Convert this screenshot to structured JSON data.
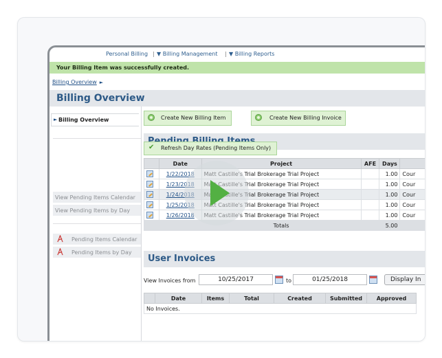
{
  "nav": {
    "personal": "Personal Billing",
    "sep": "|",
    "management": "▼ Billing Management",
    "reports": "▼ Billing Reports"
  },
  "alert": {
    "message": "Your Billing Item was successfully created."
  },
  "breadcrumb": {
    "item": "Billing Overview",
    "arrow": "►"
  },
  "page": {
    "title": "Billing Overview"
  },
  "sidebar": {
    "active": "Billing Overview",
    "active_marker": "►",
    "links": [
      "View Pending Items Calendar",
      "View Pending Items by Day"
    ],
    "pdf_links": [
      "Pending Items Calendar",
      "Pending Items by Day"
    ]
  },
  "actions": {
    "create_item": "Create New Billing Item",
    "create_invoice": "Create New Billing Invoice"
  },
  "pending": {
    "title": "Pending Billing Items",
    "refresh": "Refresh Day Rates (Pending Items Only)",
    "columns": [
      "Date",
      "Project",
      "AFE",
      "Days"
    ],
    "rows": [
      {
        "date": "1/22/2018",
        "project": "Matt Castille's Trial Brokerage Trial Project",
        "afe": "",
        "days": "1.00",
        "extra": "Cour"
      },
      {
        "date": "1/23/2018",
        "project": "Matt Castille's Trial Brokerage Trial Project",
        "afe": "",
        "days": "1.00",
        "extra": "Cour"
      },
      {
        "date": "1/24/2018",
        "project": "Matt Castille's Trial Brokerage Trial Project",
        "afe": "",
        "days": "1.00",
        "extra": "Cour"
      },
      {
        "date": "1/25/2018",
        "project": "Matt Castille's Trial Brokerage Trial Project",
        "afe": "",
        "days": "1.00",
        "extra": "Cour"
      },
      {
        "date": "1/26/2018",
        "project": "Matt Castille's Trial Brokerage Trial Project",
        "afe": "",
        "days": "1.00",
        "extra": "Cour"
      }
    ],
    "totals_label": "Totals",
    "totals_days": "5.00"
  },
  "invoices": {
    "title": "User Invoices",
    "from_label": "View Invoices from",
    "from_date": "10/25/2017",
    "to_label": "to",
    "to_date": "01/25/2018",
    "display_button": "Display In",
    "columns": [
      "Date",
      "Items",
      "Total",
      "Created",
      "Submitted",
      "Approved"
    ],
    "empty": "No Invoices."
  },
  "colors": {
    "accent": "#2d5a87",
    "success": "#bfe3a9",
    "play": "#53b043"
  }
}
